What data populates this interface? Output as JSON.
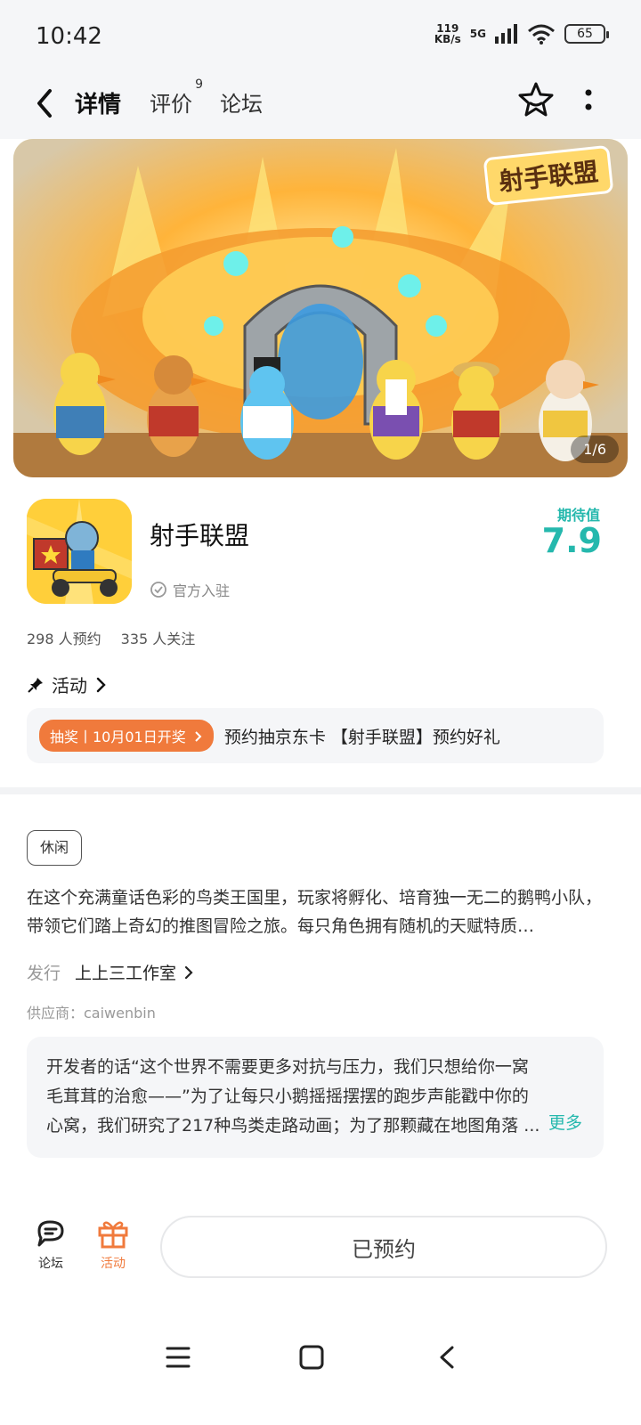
{
  "status_bar": {
    "time": "10:42",
    "net_speed_value": "119",
    "net_speed_unit": "KB/s",
    "network": "5G",
    "battery": "65"
  },
  "nav": {
    "tabs": [
      {
        "label": "详情",
        "active": true
      },
      {
        "label": "评价",
        "badge": "9"
      },
      {
        "label": "论坛"
      }
    ]
  },
  "banner": {
    "logo_text": "射手联盟",
    "counter": "1/6"
  },
  "app": {
    "name": "射手联盟",
    "official_label": "官方入驻",
    "expect_label": "期待值",
    "expect_value": "7.9",
    "stats": {
      "reservations": "298 人预约",
      "followers": "335 人关注"
    }
  },
  "activity": {
    "title": "活动",
    "tag": "抽奖丨10月01日开奖",
    "text": "预约抽京东卡 【射手联盟】预约好礼"
  },
  "details": {
    "genre": "休闲",
    "description": "在这个充满童话色彩的鸟类王国里，玩家将孵化、培育独一无二的鹅鸭小队，带领它们踏上奇幻的推图冒险之旅。每只角色拥有随机的天赋特质…",
    "publisher_label": "发行",
    "publisher_value": "上上三工作室",
    "supplier": "供应商：caiwenbin",
    "developer_note": "开发者的话“这个世界不需要更多对抗与压力，我们只想给你一窝毛茸茸的治愈——”为了让每只小鹅摇摇摆摆的跑步声能戳中你的心窝，我们研究了217种鸟类走路动画；为了那颗藏在地图角落 ...",
    "more_label": "更多"
  },
  "bottom_bar": {
    "forum_label": "论坛",
    "activity_label": "活动",
    "reserve_button": "已预约"
  },
  "colors": {
    "accent_teal": "#25b8ad",
    "accent_orange": "#f07a3c",
    "card_bg": "#f5f6f8"
  }
}
